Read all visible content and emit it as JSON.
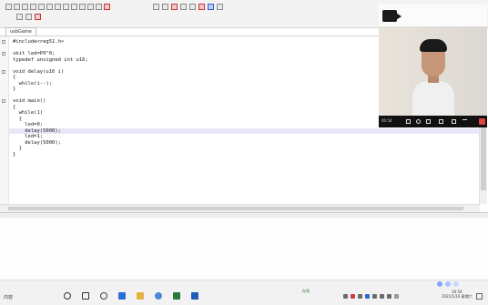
{
  "editor": {
    "tab_label": "usbGame",
    "lines": [
      {
        "text": "#include<reg51.h>",
        "hl": false,
        "fold": true
      },
      {
        "text": "",
        "hl": false
      },
      {
        "text": "sbit led=P0^0;",
        "hl": false,
        "fold": true
      },
      {
        "text": "typedef unsigned int u16;",
        "hl": false
      },
      {
        "text": "",
        "hl": false
      },
      {
        "text": "void delay(u16 i)",
        "hl": false,
        "fold": true
      },
      {
        "text": "{",
        "hl": false
      },
      {
        "text": "  while(i--);",
        "hl": false
      },
      {
        "text": "}",
        "hl": false
      },
      {
        "text": "",
        "hl": false
      },
      {
        "text": "void main()",
        "hl": false,
        "fold": true
      },
      {
        "text": "{",
        "hl": false
      },
      {
        "text": "  while(1)",
        "hl": false
      },
      {
        "text": "  {",
        "hl": false
      },
      {
        "text": "    led=0;",
        "hl": false
      },
      {
        "text": "    delay(5000);",
        "hl": true
      },
      {
        "text": "    led=1;",
        "hl": false
      },
      {
        "text": "    delay(5000);",
        "hl": false
      },
      {
        "text": "  }",
        "hl": false
      },
      {
        "text": "}",
        "hl": false
      }
    ]
  },
  "camera": {
    "duration": "00:54",
    "bar_icons": [
      "caption-icon",
      "mic-icon",
      "camera-icon",
      "share-icon",
      "record-icon",
      "more-icon"
    ]
  },
  "taskbar": {
    "left_text": "内容",
    "mid_text": "在线",
    "time": "16:54",
    "date": "2021/1/16 星期六"
  },
  "colors": {
    "highlight": "#e7e7f8",
    "record_button": "#e14343"
  }
}
